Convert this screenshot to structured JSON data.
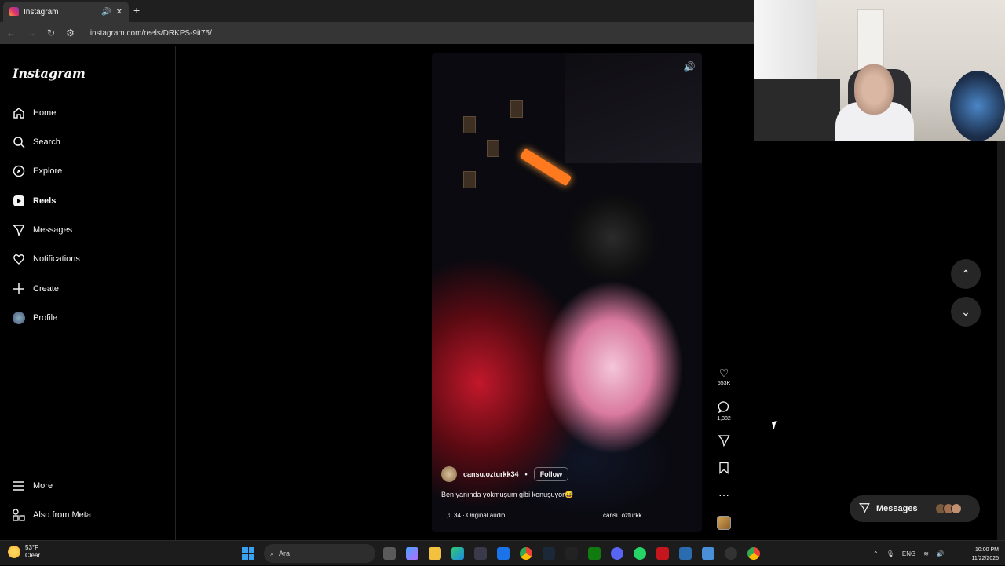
{
  "browser": {
    "tab_title": "Instagram",
    "url": "instagram.com/reels/DRKPS-9it75/"
  },
  "sidebar": {
    "logo": "Instagram",
    "items": [
      {
        "label": "Home",
        "icon": "home-icon"
      },
      {
        "label": "Search",
        "icon": "search-icon"
      },
      {
        "label": "Explore",
        "icon": "compass-icon"
      },
      {
        "label": "Reels",
        "icon": "reels-icon"
      },
      {
        "label": "Messages",
        "icon": "send-icon"
      },
      {
        "label": "Notifications",
        "icon": "heart-icon"
      },
      {
        "label": "Create",
        "icon": "plus-icon"
      },
      {
        "label": "Profile",
        "icon": "avatar-icon"
      }
    ],
    "bottom": [
      {
        "label": "More",
        "icon": "menu-icon"
      },
      {
        "label": "Also from Meta",
        "icon": "meta-icon"
      }
    ]
  },
  "reel": {
    "username": "cansu.ozturkk34",
    "follow_label": "Follow",
    "caption": "Ben yanında yokmuşum gibi konuşuyor😅",
    "audio": "34 · Original audio",
    "audio_user": "cansu.ozturkk"
  },
  "actions": {
    "likes": "553K",
    "comments": "1,382"
  },
  "messages_pill": {
    "label": "Messages"
  },
  "taskbar": {
    "temp": "53°F",
    "weather": "Clear",
    "search_placeholder": "Ara",
    "lang": "ENG",
    "time": "10:00 PM",
    "date": "11/22/2025"
  },
  "colors": {
    "background": "#000000",
    "panel": "#262626",
    "text": "#f5f5f5"
  }
}
